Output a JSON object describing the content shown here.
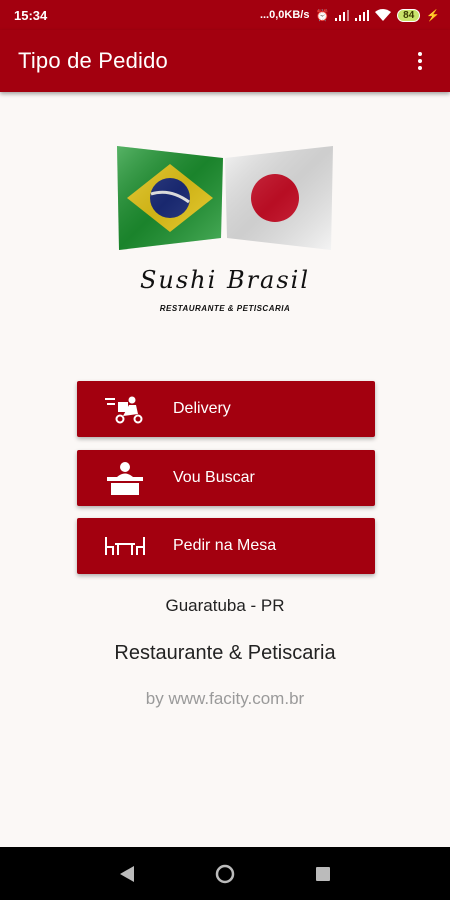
{
  "status_bar": {
    "time": "15:34",
    "network_speed": "...0,0KB/s",
    "battery_level": "84"
  },
  "app_bar": {
    "title": "Tipo de Pedido"
  },
  "brand": {
    "name": "Sushi Brasil",
    "subtitle": "RESTAURANTE & PETISCARIA"
  },
  "order_types": [
    {
      "label": "Delivery",
      "icon": "delivery-scooter-icon"
    },
    {
      "label": "Vou Buscar",
      "icon": "pickup-counter-icon"
    },
    {
      "label": "Pedir na Mesa",
      "icon": "table-chairs-icon"
    }
  ],
  "info": {
    "city": "Guaratuba - PR",
    "tagline": "Restaurante & Petiscaria",
    "byline": "by www.facity.com.br"
  },
  "colors": {
    "primary": "#a3000f",
    "background": "#fbf8f6",
    "muted_text": "#9a9a9a"
  }
}
